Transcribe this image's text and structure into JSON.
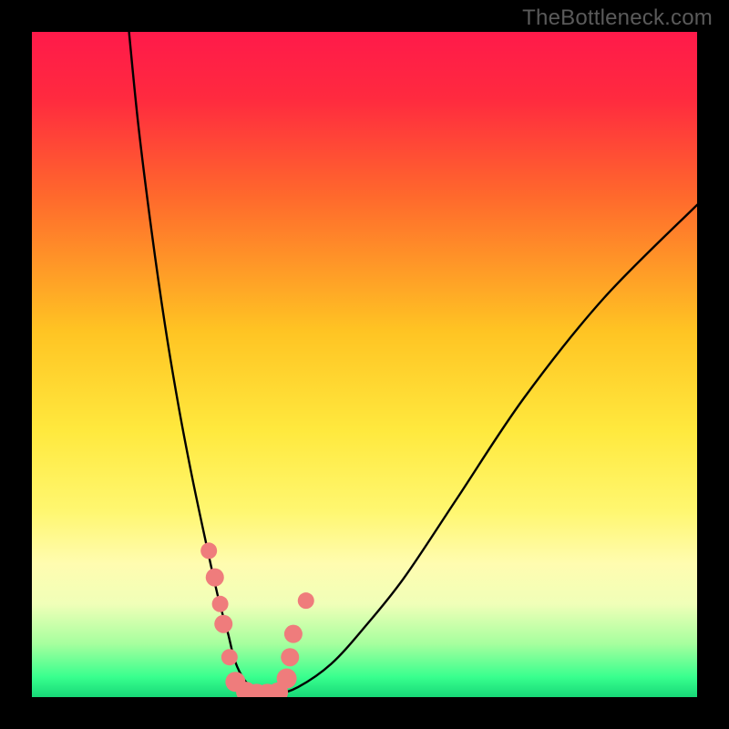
{
  "watermark": "TheBottleneck.com",
  "chart_data": {
    "type": "line",
    "title": "",
    "xlabel": "",
    "ylabel": "",
    "xlim": [
      0,
      100
    ],
    "ylim": [
      0,
      100
    ],
    "background_gradient": {
      "stops": [
        {
          "pos": 0.0,
          "color": "#ff1a4a"
        },
        {
          "pos": 0.1,
          "color": "#ff2a3f"
        },
        {
          "pos": 0.25,
          "color": "#ff6a2c"
        },
        {
          "pos": 0.45,
          "color": "#ffc423"
        },
        {
          "pos": 0.6,
          "color": "#ffe93e"
        },
        {
          "pos": 0.72,
          "color": "#fff770"
        },
        {
          "pos": 0.8,
          "color": "#fffcb0"
        },
        {
          "pos": 0.86,
          "color": "#f0ffb8"
        },
        {
          "pos": 0.92,
          "color": "#a6ff9e"
        },
        {
          "pos": 0.97,
          "color": "#38ff8e"
        },
        {
          "pos": 1.0,
          "color": "#17d877"
        }
      ]
    },
    "series": [
      {
        "name": "bottleneck-curve",
        "x": [
          14.6,
          16,
          18,
          20,
          22,
          24,
          26,
          28,
          29.5,
          30.5,
          32,
          34,
          36.5,
          40,
          45,
          50,
          56,
          64,
          74,
          86,
          100
        ],
        "y": [
          100,
          86,
          70,
          56,
          44,
          33.5,
          24,
          15,
          9.5,
          5.5,
          2.5,
          0.8,
          0.4,
          1.5,
          5,
          10.5,
          18,
          30,
          45,
          60,
          74
        ]
      }
    ],
    "markers": {
      "name": "highlight-cluster",
      "color": "#ef7c7c",
      "points": [
        {
          "x": 26.6,
          "y": 22.0,
          "r": 9
        },
        {
          "x": 27.5,
          "y": 18.0,
          "r": 10
        },
        {
          "x": 28.3,
          "y": 14.0,
          "r": 9
        },
        {
          "x": 28.8,
          "y": 11.0,
          "r": 10
        },
        {
          "x": 29.7,
          "y": 6.0,
          "r": 9
        },
        {
          "x": 30.6,
          "y": 2.3,
          "r": 11
        },
        {
          "x": 32.2,
          "y": 0.8,
          "r": 11
        },
        {
          "x": 33.8,
          "y": 0.5,
          "r": 11
        },
        {
          "x": 35.4,
          "y": 0.5,
          "r": 11
        },
        {
          "x": 37.0,
          "y": 0.7,
          "r": 11
        },
        {
          "x": 38.3,
          "y": 2.8,
          "r": 11
        },
        {
          "x": 38.8,
          "y": 6.0,
          "r": 10
        },
        {
          "x": 39.3,
          "y": 9.5,
          "r": 10
        },
        {
          "x": 41.2,
          "y": 14.5,
          "r": 9
        }
      ]
    }
  }
}
